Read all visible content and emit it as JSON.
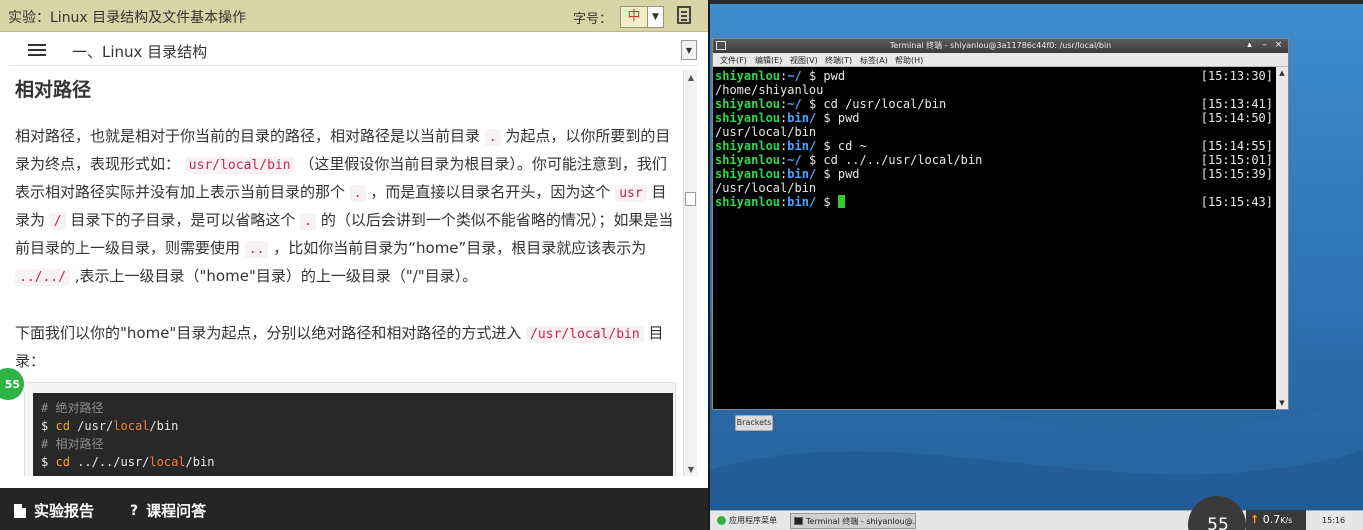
{
  "doc": {
    "title": "实验：Linux 目录结构及文件基本操作",
    "font_size_label": "字号：",
    "font_size_value": "中",
    "chapter": "一、Linux 目录结构",
    "section_title": "相对路径",
    "para1": [
      "相对路径，也就是相对于你当前的目录的路径，相对路径是以当前目录",
      ".",
      "为起点，以你所要到的目录为终点，表现形式如：",
      "usr/local/bin",
      "（这里假设你当前目录为根目录）。你可能注意到，我们表示相对路径实际并没有加上表示当前目录的那个",
      ".",
      "，而是直接以目录名开头，因为这个",
      "usr",
      "目录为",
      "/",
      "目录下的子目录，是可以省略这个",
      ".",
      "的（以后会讲到一个类似不能省略的情况）；如果是当前目录的上一级目录，则需要使用",
      "..",
      "，比如你当前目录为“home”目录，根目录就应该表示为",
      "../../",
      ",表示上一级目录（\"home\"目录）的上一级目录（\"/\"目录）。"
    ],
    "para2": [
      "下面我们以你的\"home\"目录为起点，分别以绝对路径和相对路径的方式进入",
      "/usr/local/bin",
      "目录："
    ],
    "code": {
      "comment_abs": "# 绝对路径",
      "dollar": "$",
      "cmd": "cd",
      "path_abs_a": "/usr/",
      "path_abs_b": "local",
      "path_abs_c": "/bin",
      "comment_rel": "# 相对路径",
      "path_rel_a": "../../usr/",
      "path_rel_b": "local",
      "path_rel_c": "/bin"
    },
    "progress_badge": "55",
    "footer": {
      "report": "实验报告",
      "qa": "课程问答",
      "qa_glyph": "?"
    }
  },
  "terminal": {
    "title": "Terminal 终端 - shiyanlou@3a11786c44f0: /usr/local/bin",
    "menu": [
      "文件(F)",
      "编辑(E)",
      "视图(V)",
      "终端(T)",
      "标签(A)",
      "帮助(H)"
    ],
    "lines": [
      {
        "user": "shiyanlou",
        "path": "~/",
        "cmd": "pwd",
        "ts": "[15:13:30]"
      },
      {
        "out": "/home/shiyanlou"
      },
      {
        "user": "shiyanlou",
        "path": "~/",
        "cmd": "cd /usr/local/bin",
        "ts": "[15:13:41]"
      },
      {
        "user": "shiyanlou",
        "path": "bin/",
        "cmd": "pwd",
        "ts": "[15:14:50]"
      },
      {
        "out": "/usr/local/bin"
      },
      {
        "user": "shiyanlou",
        "path": "bin/",
        "cmd": "cd ~",
        "ts": "[15:14:55]"
      },
      {
        "user": "shiyanlou",
        "path": "~/",
        "cmd": "cd ../../usr/local/bin",
        "ts": "[15:15:01]"
      },
      {
        "user": "shiyanlou",
        "path": "bin/",
        "cmd": "pwd",
        "ts": "[15:15:39]"
      },
      {
        "out": "/usr/local/bin"
      },
      {
        "user": "shiyanlou",
        "path": "bin/",
        "cmd": "",
        "ts": "[15:15:43]",
        "cursor": true
      }
    ]
  },
  "desktop": {
    "brackets": "Brackets",
    "taskbar": {
      "start": "应用程序菜单",
      "terminal_task": "Terminal 终端 - shiyanlou@...",
      "clock": "15:16"
    },
    "net": {
      "value": "55",
      "speed": "0.7",
      "unit": "K/s"
    }
  },
  "colors": {
    "accent_green": "#2fb345",
    "header_bg": "#d9d4a6",
    "prompt_green": "#2ed94c",
    "prompt_blue": "#4aa3ff"
  }
}
